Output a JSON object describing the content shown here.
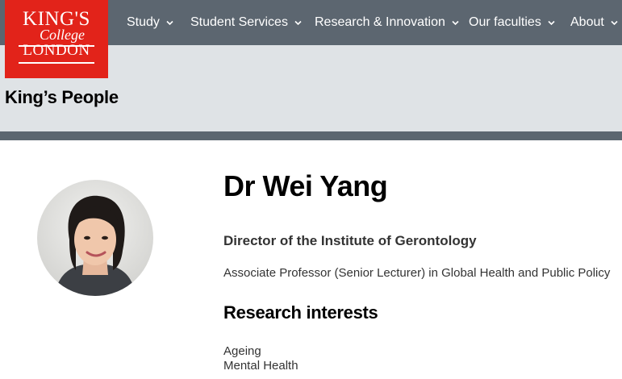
{
  "logo": {
    "line1": "KING'S",
    "line2": "College",
    "line3": "LONDON"
  },
  "nav": {
    "items": [
      "Study",
      "Student Services",
      "Research & Innovation",
      "Our faculties",
      "About"
    ]
  },
  "section": {
    "title": "King’s People"
  },
  "profile": {
    "name": "Dr Wei Yang",
    "role1": "Director of the Institute of Gerontology",
    "role2": "Associate Professor (Senior Lecturer) in Global Health and Public Policy"
  },
  "research": {
    "heading": "Research interests",
    "items": [
      "Ageing",
      "Mental Health"
    ]
  },
  "colors": {
    "brand_red": "#e2231a",
    "nav_grey": "#5c6670",
    "band_grey": "#dfe3e6"
  }
}
